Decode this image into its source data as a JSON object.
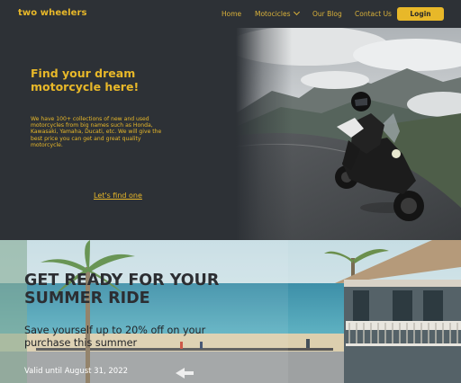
{
  "nav": {
    "logo": "two wheelers",
    "links": [
      "Home",
      "Motocicles",
      "Our Blog",
      "Contact Us"
    ],
    "login_label": "Login"
  },
  "hero": {
    "title": "Find your dream motorcycle here!",
    "body": "We have 100+ collections of new and used motorcycles from big names such as Honda, Kawasaki, Yamaha, Ducati, etc. We will give the best price you can get and great quality motorcycle.",
    "cta": "Let's find one"
  },
  "promo": {
    "title": "GET READY FOR YOUR SUMMER RIDE",
    "subtitle": "Save yourself up to 20% off on your purchase this summer",
    "valid": "Valid until August 31, 2022"
  },
  "colors": {
    "accent": "#e8b829",
    "background": "#2d3136"
  },
  "icons": {
    "dropdown": "chevron-down-icon"
  }
}
